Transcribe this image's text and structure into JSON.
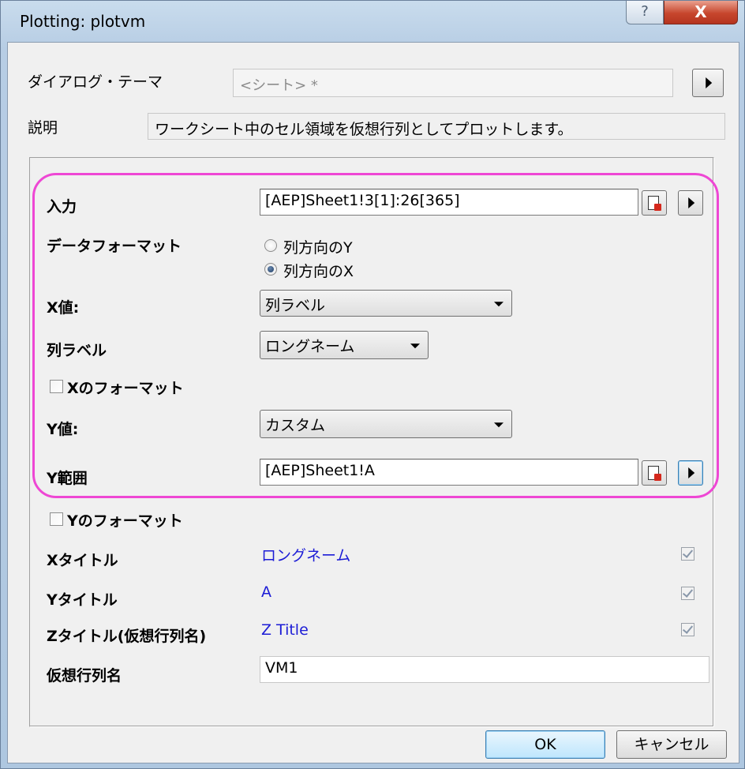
{
  "window": {
    "title": "Plotting: plotvm",
    "help_glyph": "?",
    "close_glyph": "X"
  },
  "theme": {
    "label": "ダイアログ・テーマ",
    "value": "<シート> *"
  },
  "description": {
    "label": "説明",
    "value": "ワークシート中のセル領域を仮想行列としてプロットします。"
  },
  "input": {
    "label": "入力",
    "value": "[AEP]Sheet1!3[1]:26[365]"
  },
  "data_format": {
    "label": "データフォーマット",
    "options": [
      "列方向のY",
      "列方向のX"
    ],
    "selected": "列方向のX"
  },
  "x_value": {
    "label": "X値:",
    "value": "列ラベル"
  },
  "col_label": {
    "label": "列ラベル",
    "value": "ロングネーム"
  },
  "x_format": {
    "label": "Xのフォーマット",
    "checked": false
  },
  "y_value": {
    "label": "Y値:",
    "value": "カスタム"
  },
  "y_range": {
    "label": "Y範囲",
    "value": "[AEP]Sheet1!A"
  },
  "y_format": {
    "label": "Yのフォーマット",
    "checked": false
  },
  "x_title": {
    "label": "Xタイトル",
    "value": "ロングネーム",
    "checked": true
  },
  "y_title": {
    "label": "Yタイトル",
    "value": "A",
    "checked": true
  },
  "z_title": {
    "label": "Zタイトル(仮想行列名)",
    "value": "Z Title",
    "checked": true
  },
  "vm_name": {
    "label": "仮想行列名",
    "value": "VM1"
  },
  "buttons": {
    "ok": "OK",
    "cancel": "キャンセル"
  },
  "colors": {
    "highlight": "#ee47d4",
    "title_value_text": "#1c1cd6",
    "close_button": "#c7462d"
  }
}
